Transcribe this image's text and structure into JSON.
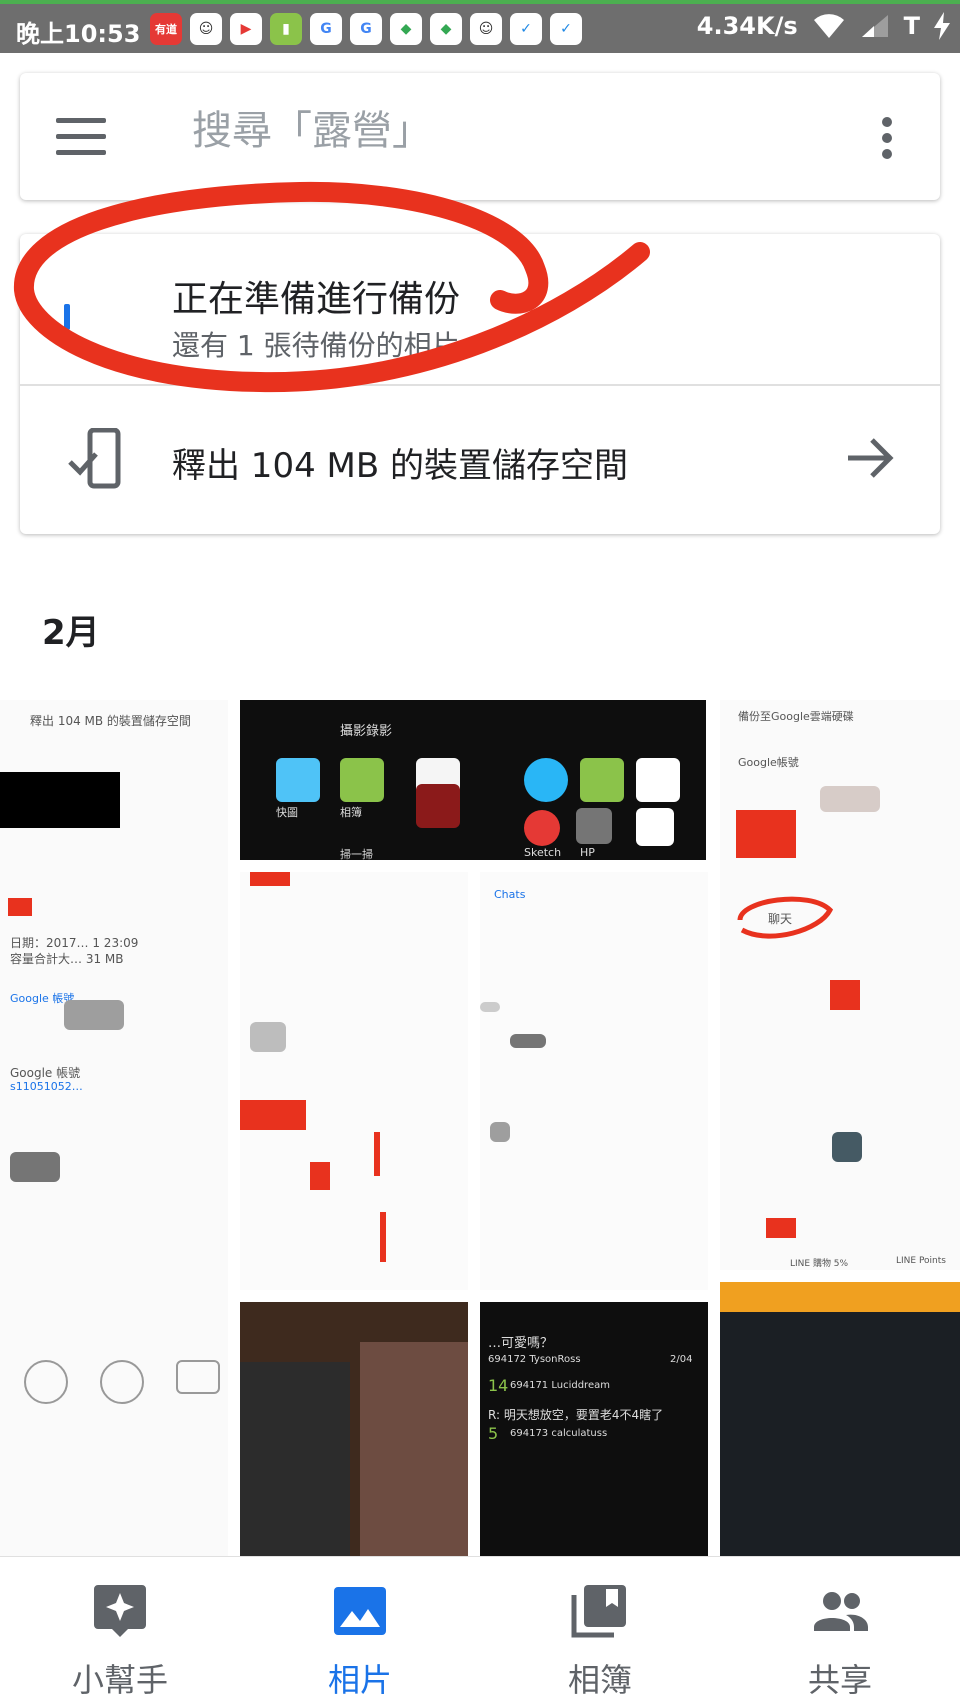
{
  "status_bar": {
    "time": "晚上10:53",
    "app_icons": [
      "有道",
      "bb",
      "▶",
      "▮",
      "G",
      "G",
      "map",
      "map",
      "bb",
      "✓",
      "✓"
    ],
    "network_speed": "4.34K/s",
    "carrier": "T"
  },
  "search": {
    "placeholder": "搜尋「露營」",
    "menu_icon": "hamburger-menu-icon",
    "more_icon": "more-vert-icon"
  },
  "backup_card": {
    "title": "正在準備進行備份",
    "subtitle": "還有 1 張待備份的相片",
    "free_space_label": "釋出 104 MB 的裝置儲存空間",
    "free_space_icon": "phone-check-icon",
    "arrow_icon": "arrow-right-icon"
  },
  "photos": {
    "month_label": "2月",
    "tile_texts": {
      "t1_top": "釋出 104 MB 的裝置儲存空間",
      "t1_date": "日期：2017… 1 23:09",
      "t1_size": "容量合計大… 31 MB",
      "t1_account": "Google 帳號",
      "t1_google": "Google 帳號",
      "t1_id": "s11051052…",
      "t2_title": "攝影錄影",
      "t2_lbl1": "快圖",
      "t2_lbl2": "相簿",
      "t2_lbl3": "掃一掃",
      "t2_lbl4": "Sketch",
      "t2_lbl5": "HP",
      "t3_title": "備份至Google雲端硬碟",
      "t3_account": "Google帳號",
      "t3_chat": "聊天",
      "t3_line1": "LINE 購物 5%",
      "t3_line2": "LINE Points",
      "chats_header": "Chats",
      "chat1": "…可愛嗎？",
      "chat1_user": "694172 TysonRoss",
      "chat1_date": "2/04",
      "chat2_num": "14",
      "chat2_user": "694171 Luciddream",
      "chat3": "R: 明天想放空，要置老4不4瞎了",
      "chat3_num": "5",
      "chat3_user": "694173 calculatuss"
    }
  },
  "bottom_nav": {
    "items": [
      {
        "label": "小幫手",
        "icon": "assistant-icon"
      },
      {
        "label": "相片",
        "icon": "photos-icon"
      },
      {
        "label": "相簿",
        "icon": "albums-icon"
      },
      {
        "label": "共享",
        "icon": "sharing-icon"
      }
    ],
    "active_index": 1,
    "active_color": "#1a73e8",
    "inactive_color": "#5f6368"
  },
  "annotation": {
    "color": "#e8321e",
    "shape": "hand-drawn red ellipse around backup status"
  }
}
